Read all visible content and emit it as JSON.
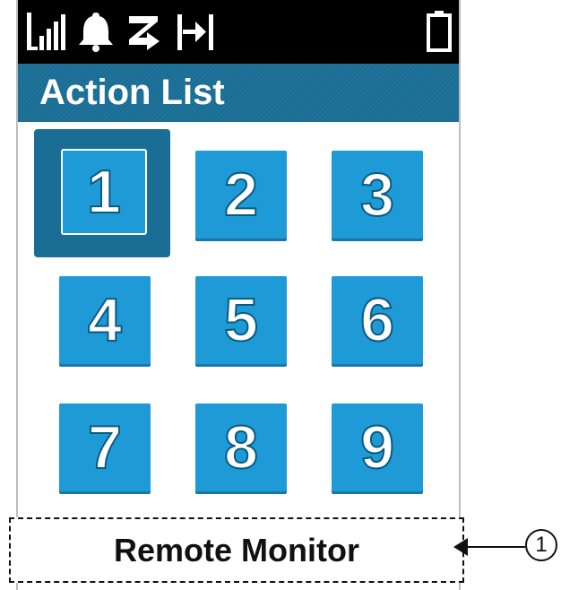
{
  "status_bar": {
    "icons": [
      "signal-strength-icon",
      "bell-icon",
      "scan-icon",
      "talkaround-icon",
      "battery-icon"
    ]
  },
  "title_bar": {
    "title": "Action List"
  },
  "keypad": {
    "keys": [
      "1",
      "2",
      "3",
      "4",
      "5",
      "6",
      "7",
      "8",
      "9"
    ],
    "selected": "1"
  },
  "action": {
    "label": "Remote Monitor"
  },
  "callout": {
    "number": "1"
  },
  "colors": {
    "status_bar_bg": "#000000",
    "title_bar_bg": "#1a6e95",
    "key_bg": "#1e9bd7",
    "key_selected_bg": "#1a6e95",
    "text_light": "#ffffff",
    "text_dark": "#111111"
  }
}
